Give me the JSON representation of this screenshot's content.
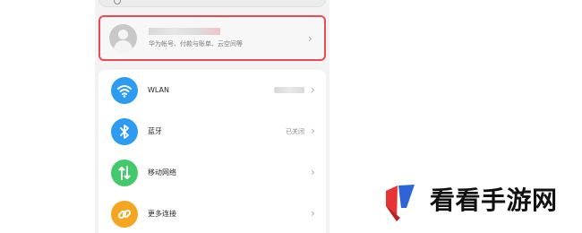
{
  "account": {
    "subtitle": "华为帐号、付款与账单、云空间等"
  },
  "settings": [
    {
      "label": "WLAN",
      "status": "",
      "icon": "wifi-icon"
    },
    {
      "label": "蓝牙",
      "status": "已关闭",
      "icon": "bluetooth-icon"
    },
    {
      "label": "移动网络",
      "status": "",
      "icon": "mobile-network-icon"
    },
    {
      "label": "更多连接",
      "status": "",
      "icon": "link-icon"
    }
  ],
  "watermark": {
    "text": "看看手游网"
  },
  "colors": {
    "highlight": "#e84b51",
    "wifi": "#2d9bf0",
    "bluetooth": "#2d9bf0",
    "mobile": "#42c96c",
    "more": "#f4a623",
    "logo_red": "#e63333",
    "logo_blue": "#2f64d8"
  }
}
